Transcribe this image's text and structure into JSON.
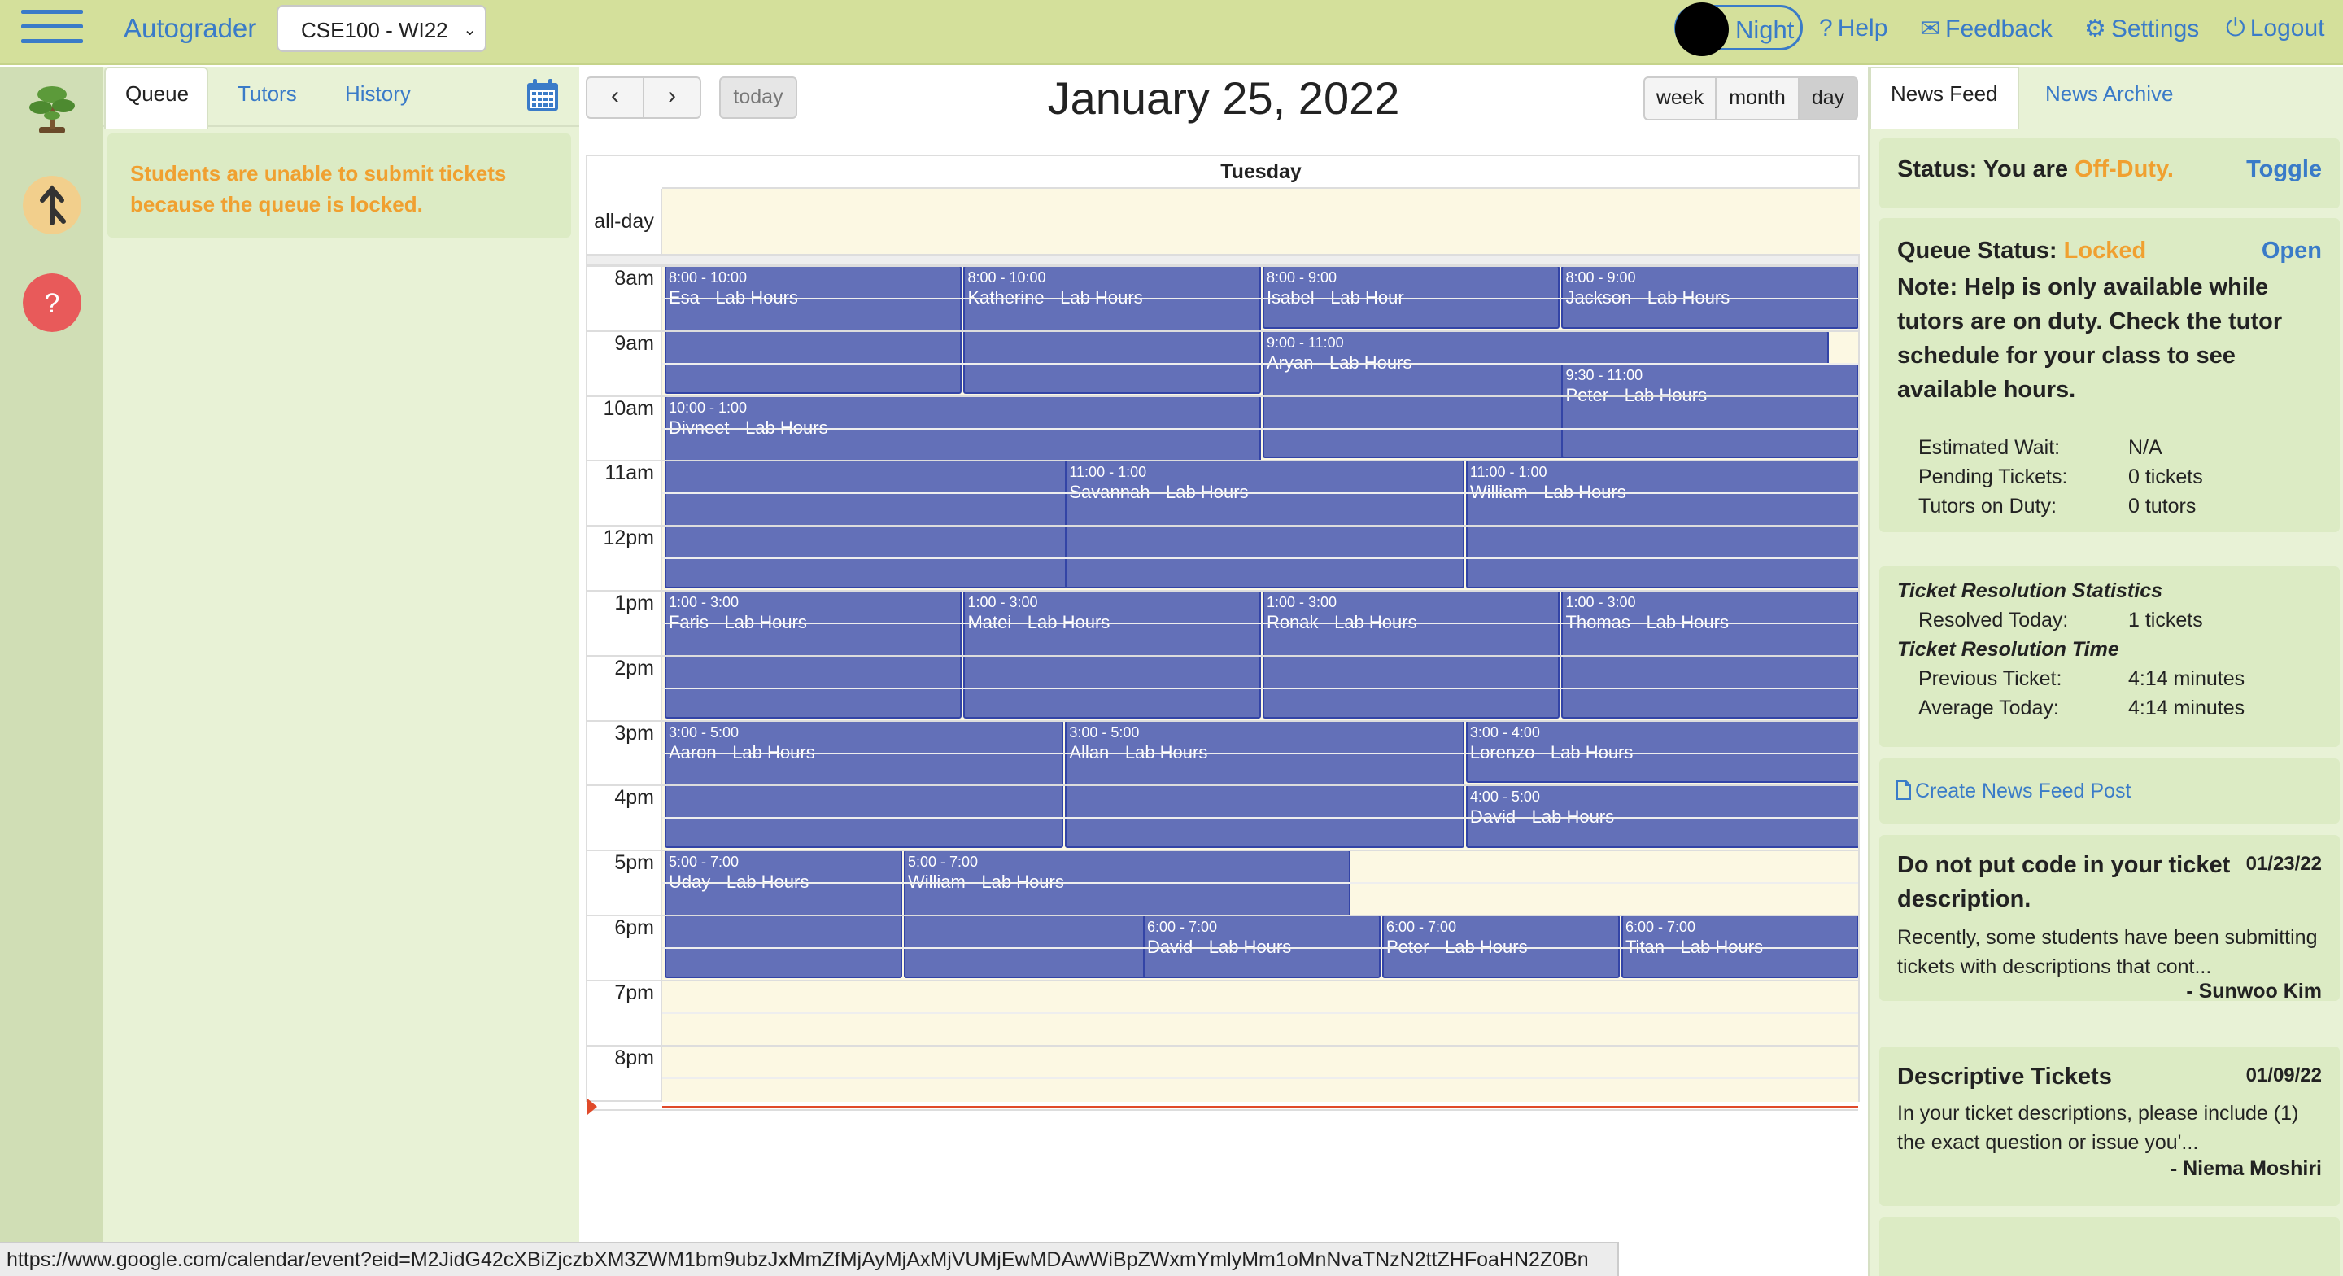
{
  "topbar": {
    "brand": "Autograder",
    "course": "CSE100 - WI22",
    "night_label": "Night",
    "links": [
      {
        "key": "help",
        "icon": "?",
        "label": "Help"
      },
      {
        "key": "feedback",
        "icon": "✉",
        "label": "Feedback"
      },
      {
        "key": "settings",
        "icon": "⚙",
        "label": "Settings"
      },
      {
        "key": "logout",
        "icon": "⏻",
        "label": "Logout"
      }
    ]
  },
  "queue_panel": {
    "tabs": [
      "Queue",
      "Tutors",
      "History"
    ],
    "active_tab": "Queue",
    "locked_message": "Students are unable to submit tickets because the queue is locked."
  },
  "calendar": {
    "title": "January 25, 2022",
    "today_label": "today",
    "prev_icon": "‹",
    "next_icon": "›",
    "views": [
      "week",
      "month",
      "day"
    ],
    "active_view": "day",
    "day_header": "Tuesday",
    "allday_label": "all-day",
    "hours": [
      "8am",
      "9am",
      "10am",
      "11am",
      "12pm",
      "1pm",
      "2pm",
      "3pm",
      "4pm",
      "5pm",
      "6pm",
      "7pm",
      "8pm"
    ],
    "events": [
      {
        "time": "8:00 - 10:00",
        "title": "Esa - Lab Hours"
      },
      {
        "time": "8:00 - 10:00",
        "title": "Katherine - Lab Hours"
      },
      {
        "time": "8:00 - 9:00",
        "title": "Isabel - Lab Hour"
      },
      {
        "time": "8:00 - 9:00",
        "title": "Jackson - Lab Hours"
      },
      {
        "time": "9:00 - 11:00",
        "title": "Aryan - Lab Hours"
      },
      {
        "time": "9:30 - 11:00",
        "title": "Peter - Lab Hours"
      },
      {
        "time": "10:00 - 1:00",
        "title": "Divneet - Lab Hours"
      },
      {
        "time": "11:00 - 1:00",
        "title": "Savannah - Lab Hours"
      },
      {
        "time": "11:00 - 1:00",
        "title": "William - Lab Hours"
      },
      {
        "time": "1:00 - 3:00",
        "title": "Faris - Lab Hours"
      },
      {
        "time": "1:00 - 3:00",
        "title": "Matei - Lab Hours"
      },
      {
        "time": "1:00 - 3:00",
        "title": "Ronak - Lab Hours"
      },
      {
        "time": "1:00 - 3:00",
        "title": "Thomas - Lab Hours"
      },
      {
        "time": "3:00 - 5:00",
        "title": "Aaron - Lab Hours"
      },
      {
        "time": "3:00 - 5:00",
        "title": "Allan - Lab Hours"
      },
      {
        "time": "3:00 - 4:00",
        "title": "Lorenzo - Lab Hours"
      },
      {
        "time": "4:00 - 5:00",
        "title": "David - Lab Hours"
      },
      {
        "time": "5:00 - 7:00",
        "title": "Uday - Lab Hours"
      },
      {
        "time": "5:00 - 7:00",
        "title": "William - Lab Hours"
      },
      {
        "time": "6:00 - 7:00",
        "title": "David - Lab Hours"
      },
      {
        "time": "6:00 - 7:00",
        "title": "Peter - Lab Hours"
      },
      {
        "time": "6:00 - 7:00",
        "title": "Titan - Lab Hours"
      }
    ]
  },
  "newsfeed": {
    "tabs": [
      "News Feed",
      "News Archive"
    ],
    "active_tab": "News Feed",
    "status_prefix": "Status: You are ",
    "status_value": "Off-Duty.",
    "toggle_label": "Toggle",
    "queue_status_prefix": "Queue Status: ",
    "queue_status_value": "Locked",
    "open_label": "Open",
    "note": "Note: Help is only available while tutors are on duty. Check the tutor schedule for your class to see available hours.",
    "stats": [
      {
        "label": "Estimated Wait:",
        "value": "N/A"
      },
      {
        "label": "Pending Tickets:",
        "value": "0 tickets"
      },
      {
        "label": "Tutors on Duty:",
        "value": "0 tutors"
      }
    ],
    "resolution_heading": "Ticket Resolution Statistics",
    "resolved_label": "Resolved Today:",
    "resolved_value": "1 tickets",
    "time_heading": "Ticket Resolution Time",
    "times": [
      {
        "label": "Previous Ticket:",
        "value": "4:14 minutes"
      },
      {
        "label": "Average Today:",
        "value": "4:14 minutes"
      }
    ],
    "create_post": "Create News Feed Post",
    "posts": [
      {
        "title": "Do not put code in your ticket description.",
        "date": "01/23/22",
        "body": "Recently, some students have been submitting tickets with descriptions that cont...",
        "author": "- Sunwoo Kim"
      },
      {
        "title": "Descriptive Tickets",
        "date": "01/09/22",
        "body": "In your ticket descriptions, please include (1) the exact question or issue you'...",
        "author": "- Niema Moshiri"
      }
    ]
  },
  "status_url": "https://www.google.com/calendar/event?eid=M2JidG42cXBiZjczbXM3ZWM1bm9ubzJxMmZfMjAyMjAxMjVUMjEwMDAwWiBpZWxmYmlyMm1oMnNvaTNzN2ttZHFoaHN2Z0Bn"
}
